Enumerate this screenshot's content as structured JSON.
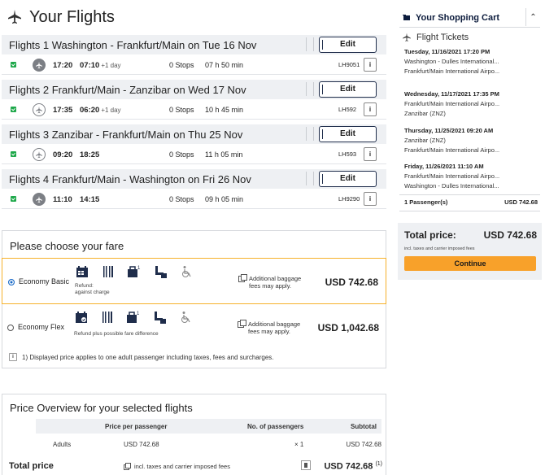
{
  "page": {
    "title": "Your Flights"
  },
  "flights": [
    {
      "header": "Flights 1 Washington - Frankfurt/Main on Tue 16 Nov",
      "edit_label": "Edit",
      "dep": "17:20",
      "arr": "07:10",
      "day_offset": "+1 day",
      "stops": "0 Stops",
      "duration": "07 h 50 min",
      "flight_no": "LH9051",
      "carrier_style": "dark",
      "info_label": "i"
    },
    {
      "header": "Flights 2 Frankfurt/Main - Zanzibar on Wed 17 Nov",
      "edit_label": "Edit",
      "dep": "17:35",
      "arr": "06:20",
      "day_offset": "+1 day",
      "stops": "0 Stops",
      "duration": "10 h 45 min",
      "flight_no": "LH592",
      "carrier_style": "light",
      "info_label": "i"
    },
    {
      "header": "Flights 3 Zanzibar - Frankfurt/Main on Thu 25 Nov",
      "edit_label": "Edit",
      "dep": "09:20",
      "arr": "18:25",
      "day_offset": "",
      "stops": "0 Stops",
      "duration": "11 h 05 min",
      "flight_no": "LH593",
      "carrier_style": "light",
      "info_label": "i"
    },
    {
      "header": "Flights 4 Frankfurt/Main - Washington on Fri 26 Nov",
      "edit_label": "Edit",
      "dep": "11:10",
      "arr": "14:15",
      "day_offset": "",
      "stops": "0 Stops",
      "duration": "09 h 05 min",
      "flight_no": "LH9290",
      "carrier_style": "dark",
      "info_label": "i"
    }
  ],
  "fare": {
    "title": "Please choose your fare",
    "options": [
      {
        "name": "Economy Basic",
        "selected": true,
        "note_line1": "Refund:",
        "note_line2": "against charge",
        "baggage_line1": "Additional baggage",
        "baggage_line2": "fees may apply.",
        "price": "USD 742.68",
        "icons": [
          "calendar-icon",
          "meal-icon",
          "carry-on-bag-icon",
          "seat-icon",
          "wheelchair-icon"
        ]
      },
      {
        "name": "Economy Flex",
        "selected": false,
        "note_line1": "Refund plus possible fare difference",
        "note_line2": "",
        "baggage_line1": "Additional baggage",
        "baggage_line2": "fees may apply.",
        "price": "USD 1,042.68",
        "icons": [
          "calendar-icon",
          "meal-icon",
          "carry-on-bag-icon",
          "seat-icon",
          "wheelchair-icon"
        ]
      }
    ],
    "footnote": "1) Displayed price applies to one adult passenger including taxes, fees and surcharges.",
    "footnote_icon_label": "i"
  },
  "price_overview": {
    "title": "Price Overview for your selected flights",
    "columns": [
      "Price per passenger",
      "No. of passengers",
      "Subtotal"
    ],
    "rows": [
      {
        "type": "Adults",
        "price": "USD 742.68",
        "count": "× 1",
        "subtotal": "USD 742.68"
      }
    ],
    "total_label": "Total price",
    "total_note": "incl. taxes and carrier imposed fees",
    "total_value": "USD 742.68",
    "total_footnote": "(1)"
  },
  "cart": {
    "title": "Your Shopping Cart",
    "section_title": "Flight Tickets",
    "segments": [
      {
        "datetime": "Tuesday, 11/16/2021 17:20 PM",
        "from": "Washington - Dulles International...",
        "to": "Frankfurt/Main International Airpo..."
      },
      {
        "datetime": "Wednesday, 11/17/2021 17:35 PM",
        "from": "Frankfurt/Main International Airpo...",
        "to": "Zanzibar (ZNZ)"
      },
      {
        "datetime": "Thursday, 11/25/2021 09:20 AM",
        "from": "Zanzibar (ZNZ)",
        "to": "Frankfurt/Main International Airpo..."
      },
      {
        "datetime": "Friday, 11/26/2021 11:10 AM",
        "from": "Frankfurt/Main International Airpo...",
        "to": "Washington - Dulles International..."
      }
    ],
    "passengers": "1 Passenger(s)",
    "passengers_price": "USD 742.68",
    "total_label": "Total price:",
    "total_value": "USD 742.68",
    "total_note": "incl. taxes and carrier imposed fees",
    "continue_label": "Continue"
  },
  "colors": {
    "accent_orange": "#f8a12a",
    "selected_border": "#f6b12a",
    "navy": "#0d1c3d",
    "check_green": "#1ea84a",
    "header_bg": "#eef0f3"
  }
}
